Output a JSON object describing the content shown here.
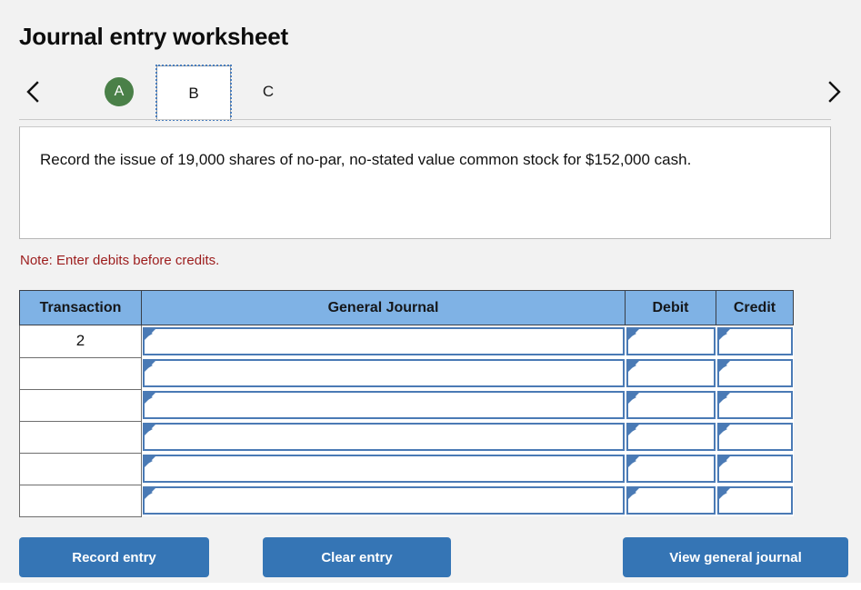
{
  "page": {
    "title": "Journal entry worksheet",
    "background_color": "#f2f2f2"
  },
  "nav": {
    "prev_icon": "chevron-left-icon",
    "next_icon": "chevron-right-icon"
  },
  "tabs": [
    {
      "label": "A",
      "state": "completed",
      "badge_color": "#4a8048"
    },
    {
      "label": "B",
      "state": "current"
    },
    {
      "label": "C",
      "state": "upcoming"
    }
  ],
  "description": {
    "text": "Record the issue of 19,000 shares of no-par, no-stated value common stock for $152,000 cash."
  },
  "note": {
    "text": "Note: Enter debits before credits.",
    "color": "#9c1c1c"
  },
  "table": {
    "header_color": "#7fb2e5",
    "columns": [
      "Transaction",
      "General Journal",
      "Debit",
      "Credit"
    ],
    "rows": [
      {
        "transaction": "2",
        "general_journal": "",
        "debit": "",
        "credit": ""
      },
      {
        "transaction": "",
        "general_journal": "",
        "debit": "",
        "credit": ""
      },
      {
        "transaction": "",
        "general_journal": "",
        "debit": "",
        "credit": ""
      },
      {
        "transaction": "",
        "general_journal": "",
        "debit": "",
        "credit": ""
      },
      {
        "transaction": "",
        "general_journal": "",
        "debit": "",
        "credit": ""
      },
      {
        "transaction": "",
        "general_journal": "",
        "debit": "",
        "credit": ""
      }
    ]
  },
  "buttons": {
    "record": "Record entry",
    "clear": "Clear entry",
    "view": "View general journal",
    "color": "#3575b5"
  }
}
